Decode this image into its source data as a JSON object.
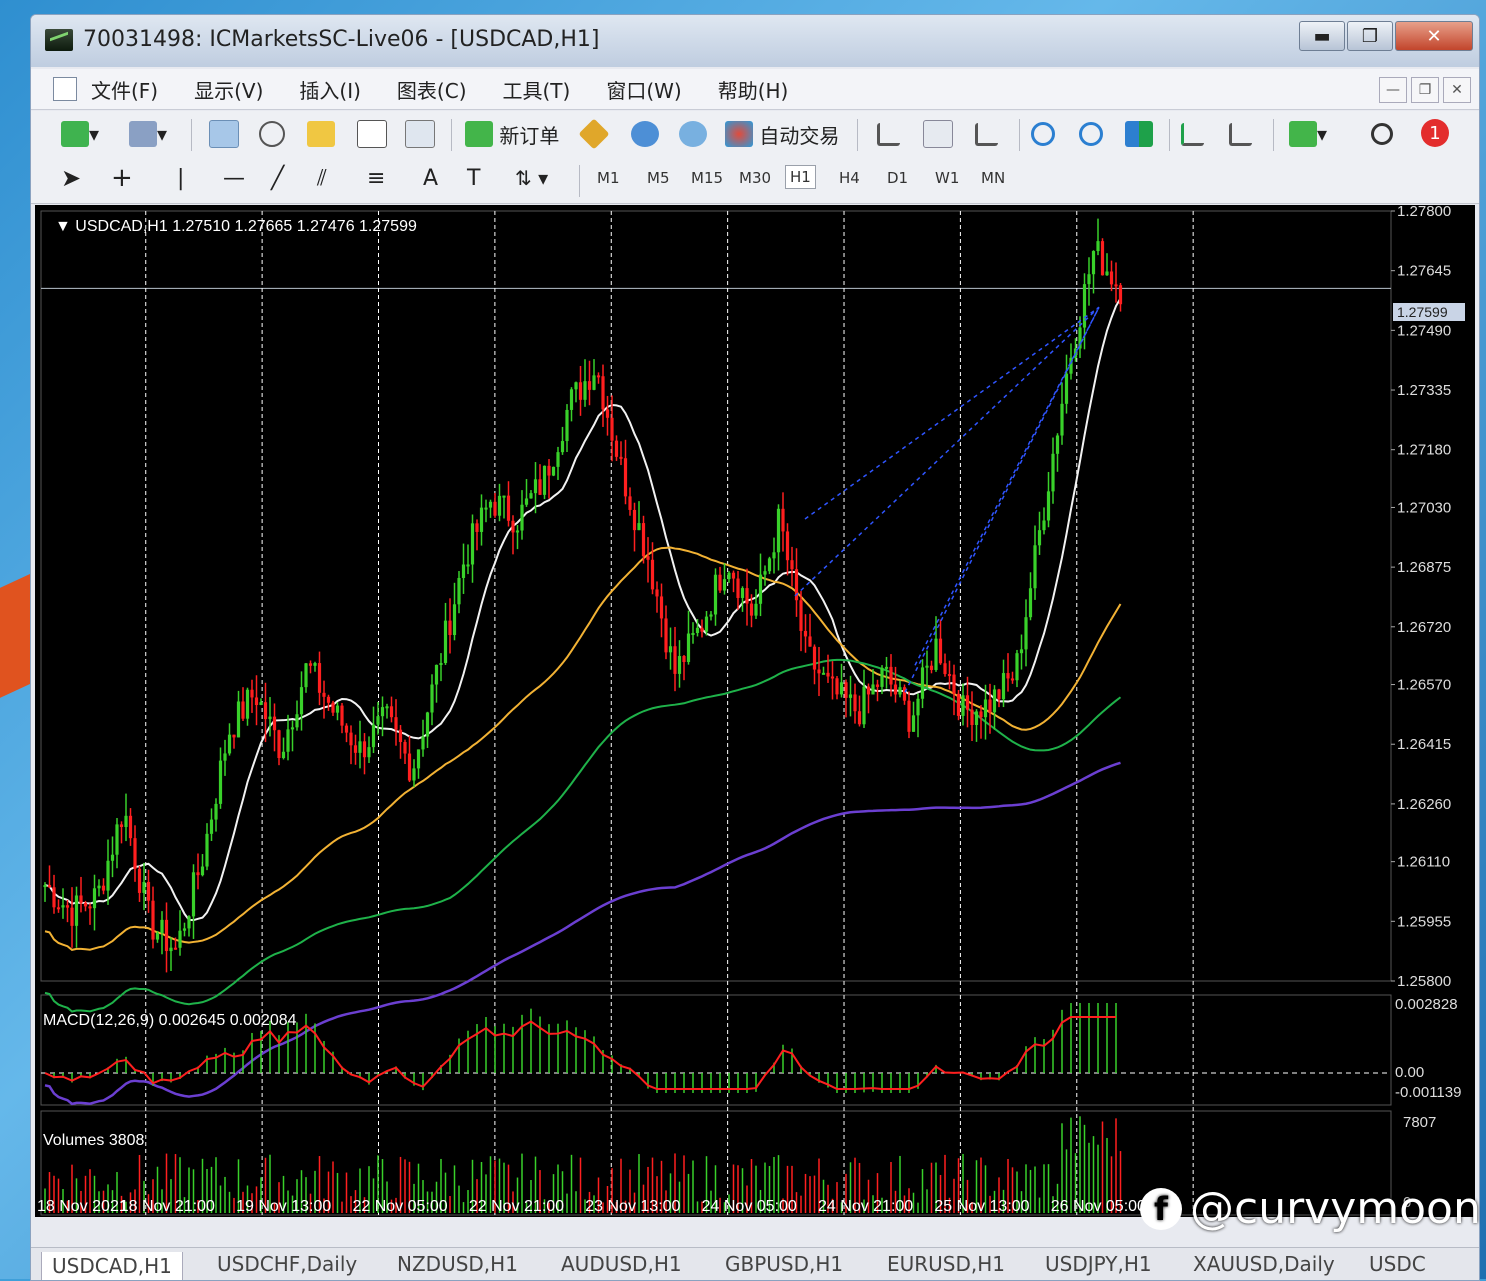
{
  "window": {
    "title": "70031498: ICMarketsSC-Live06 - [USDCAD,H1]",
    "buttons": [
      "▬",
      "❐",
      "✕"
    ]
  },
  "menu": {
    "items": [
      "文件(F)",
      "显示(V)",
      "插入(I)",
      "图表(C)",
      "工具(T)",
      "窗口(W)",
      "帮助(H)"
    ]
  },
  "toolbar": {
    "new_order": "新订单",
    "auto_trade": "自动交易",
    "alert_count": "1"
  },
  "timeframes": [
    "M1",
    "M5",
    "M15",
    "M30",
    "H1",
    "H4",
    "D1",
    "W1",
    "MN"
  ],
  "selected_timeframe": "H1",
  "chart": {
    "header": "▼ USDCAD,H1  1.27510 1.27665 1.27476 1.27599",
    "price_levels": [
      "1.27800",
      "1.27645",
      "1.27490",
      "1.27335",
      "1.27180",
      "1.27030",
      "1.26875",
      "1.26720",
      "1.26570",
      "1.26415",
      "1.26260",
      "1.26110",
      "1.25955",
      "1.25800"
    ],
    "current_price": "1.27599",
    "macd_label": "MACD(12,26,9) 0.002645 0.002084",
    "macd_levels": [
      "0.002828",
      "0.00",
      "-0.001139"
    ],
    "volume_label": "Volumes 3808",
    "volume_levels": [
      "7807",
      "0"
    ],
    "dates": [
      "18 Nov 2021",
      "18 Nov 21:00",
      "19 Nov 13:00",
      "22 Nov 05:00",
      "22 Nov 21:00",
      "23 Nov 13:00",
      "24 Nov 05:00",
      "24 Nov 21:00",
      "25 Nov 13:00",
      "26 Nov 05:00"
    ],
    "colors": {
      "bull": "#39d12a",
      "bear": "#ff1f1f",
      "ma_fast": "#f2f2f2",
      "ma_mid": "#f2b234",
      "ma_slow": "#1fb24a",
      "ma_long": "#6b3fd1",
      "trend_lines": "#2f55ff"
    }
  },
  "chart_data": {
    "type": "candlestick",
    "symbol": "USDCAD",
    "timeframe": "H1",
    "ylim": [
      1.258,
      1.278
    ],
    "last_ohlc": [
      1.2751,
      1.27665,
      1.27476,
      1.27599
    ],
    "close_path": [
      1.2605,
      1.2598,
      1.2602,
      1.2625,
      1.2595,
      1.2588,
      1.2612,
      1.2645,
      1.2655,
      1.264,
      1.2662,
      1.265,
      1.264,
      1.2648,
      1.2635,
      1.2662,
      1.269,
      1.2705,
      1.27,
      1.271,
      1.273,
      1.274,
      1.2712,
      1.269,
      1.266,
      1.2672,
      1.269,
      1.2675,
      1.27,
      1.2665,
      1.2655,
      1.265,
      1.266,
      1.2648,
      1.2668,
      1.265,
      1.2652,
      1.266,
      1.27,
      1.274,
      1.277,
      1.276
    ],
    "macd": {
      "value": 0.002645,
      "signal": 0.002084
    },
    "volume": 3808
  },
  "tabs": [
    "USDCAD,H1",
    "USDCHF,Daily",
    "NZDUSD,H1",
    "AUDUSD,H1",
    "GBPUSD,H1",
    "EURUSD,H1",
    "USDJPY,H1",
    "XAUUSD,Daily",
    "USDC"
  ],
  "watermark": "@curvymoon"
}
